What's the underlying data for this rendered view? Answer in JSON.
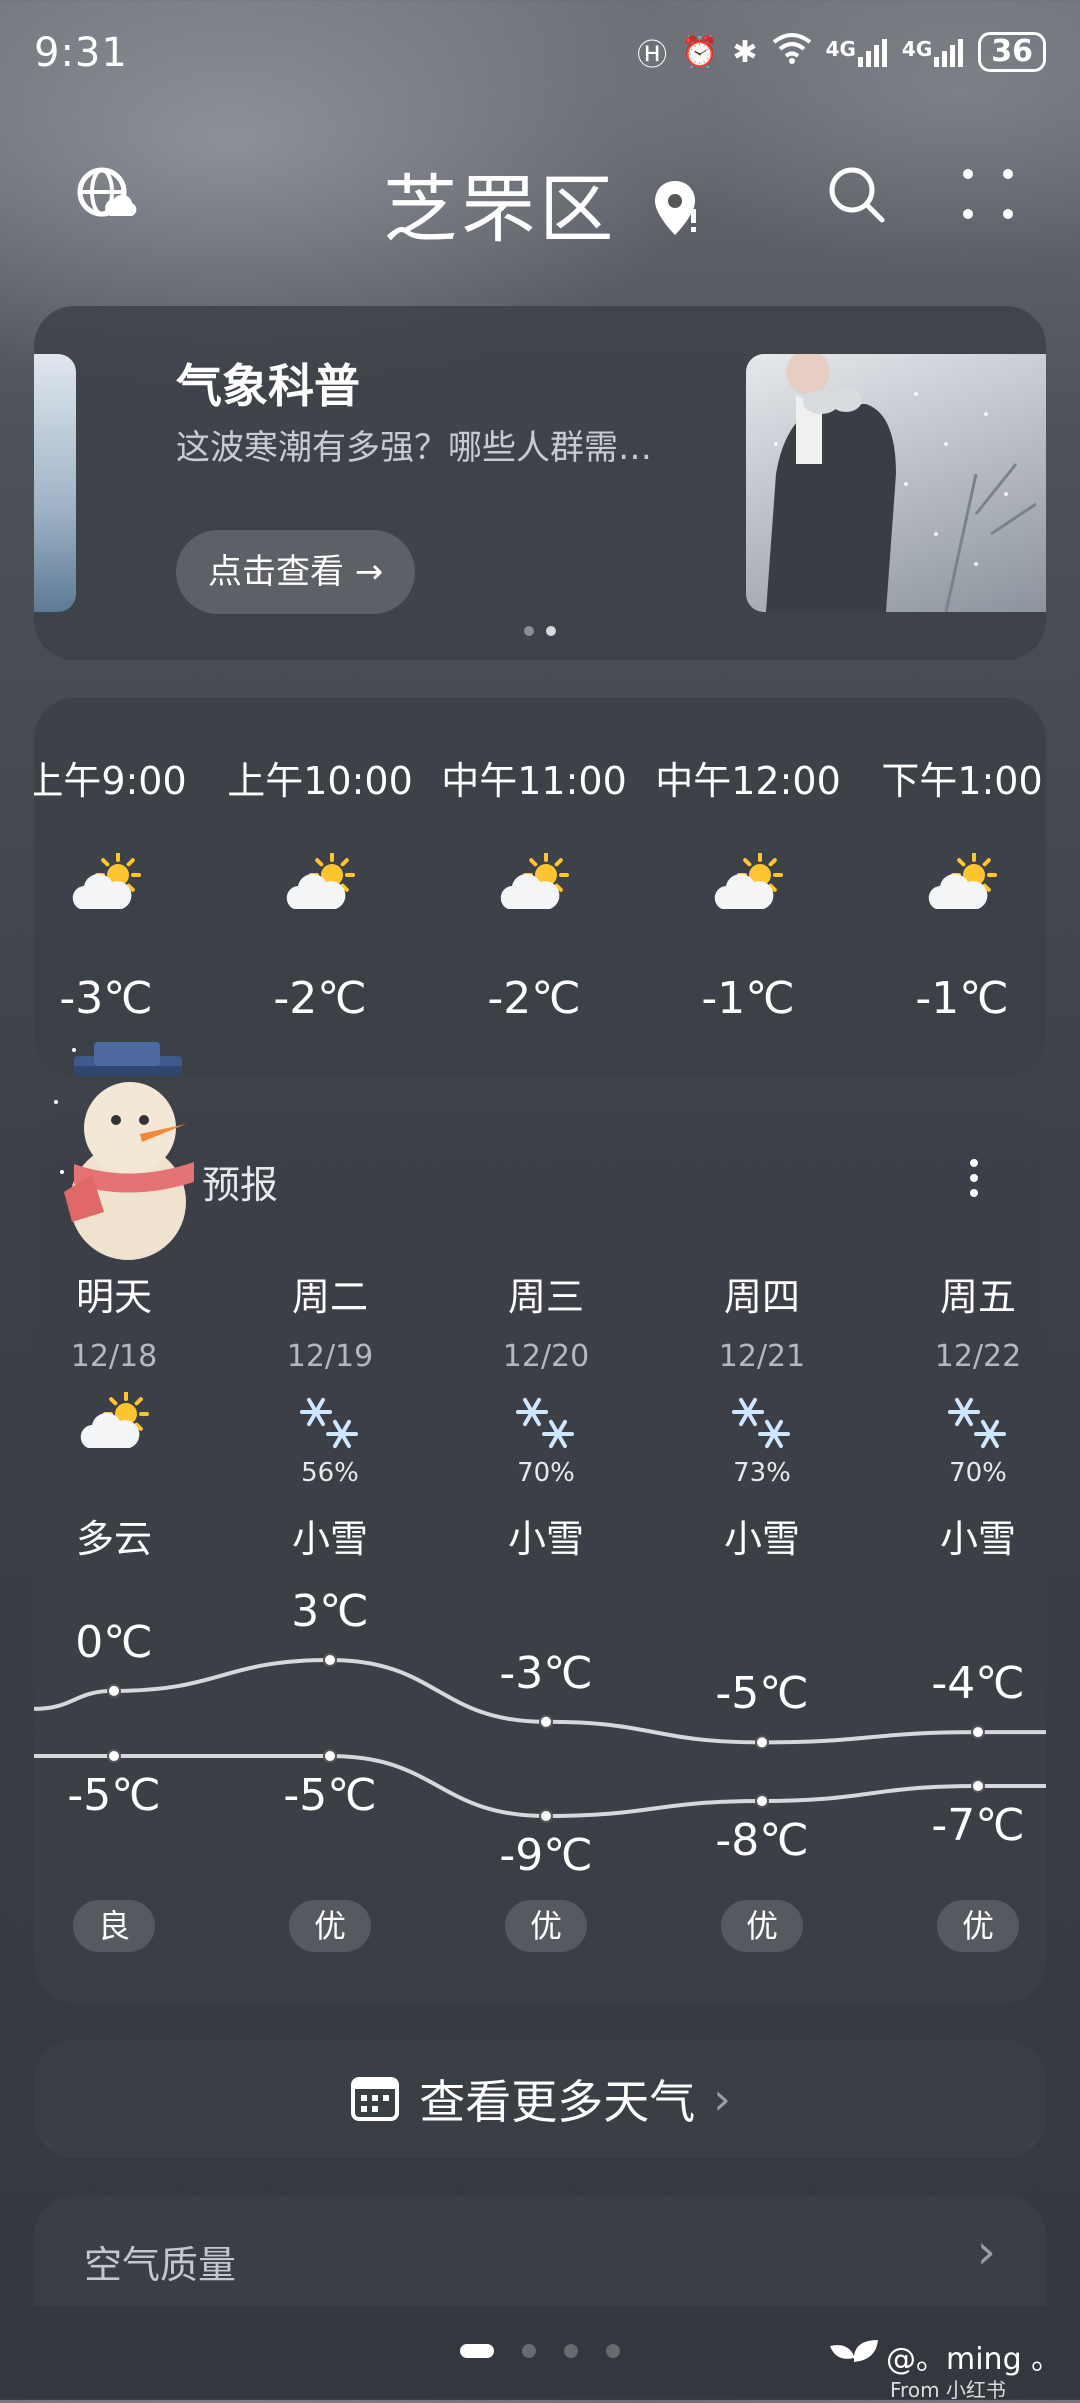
{
  "status_bar": {
    "time": "9:31",
    "network_label": "4G",
    "battery": "36"
  },
  "header": {
    "city": "芝罘区"
  },
  "banner": {
    "title": "气象科普",
    "subtitle": "这波寒潮有多强？哪些人群需…",
    "button_label": "点击查看 →"
  },
  "hourly": [
    {
      "time": "上午9:00",
      "temp": "-3℃",
      "icon": "partly-cloudy-icon"
    },
    {
      "time": "上午10:00",
      "temp": "-2℃",
      "icon": "partly-cloudy-icon"
    },
    {
      "time": "中午11:00",
      "temp": "-2℃",
      "icon": "partly-cloudy-icon"
    },
    {
      "time": "中午12:00",
      "temp": "-1℃",
      "icon": "partly-cloudy-icon"
    },
    {
      "time": "下午1:00",
      "temp": "-1℃",
      "icon": "partly-cloudy-icon"
    }
  ],
  "forecast": {
    "title_partial": "预报",
    "days": [
      {
        "day": "明天",
        "date": "12/18",
        "icon": "partly-cloudy-icon",
        "precip": "",
        "condition": "多云",
        "high": "0℃",
        "low": "-5℃",
        "aqi": "良"
      },
      {
        "day": "周二",
        "date": "12/19",
        "icon": "snow-icon",
        "precip": "56%",
        "condition": "小雪",
        "high": "3℃",
        "low": "-5℃",
        "aqi": "优"
      },
      {
        "day": "周三",
        "date": "12/20",
        "icon": "snow-icon",
        "precip": "70%",
        "condition": "小雪",
        "high": "-3℃",
        "low": "-9℃",
        "aqi": "优"
      },
      {
        "day": "周四",
        "date": "12/21",
        "icon": "snow-icon",
        "precip": "73%",
        "condition": "小雪",
        "high": "-5℃",
        "low": "-8℃",
        "aqi": "优"
      },
      {
        "day": "周五",
        "date": "12/22",
        "icon": "snow-icon",
        "precip": "70%",
        "condition": "小雪",
        "high": "-4℃",
        "low": "-7℃",
        "aqi": "优"
      }
    ]
  },
  "more_weather": {
    "label": "查看更多天气"
  },
  "air_quality": {
    "title": "空气质量"
  },
  "watermark": {
    "user": "@。ming 。",
    "source": "From 小红书"
  },
  "colors": {
    "sun": "#ffc52e",
    "snow": "#cfe6ff",
    "line": "#d6d8dc"
  }
}
